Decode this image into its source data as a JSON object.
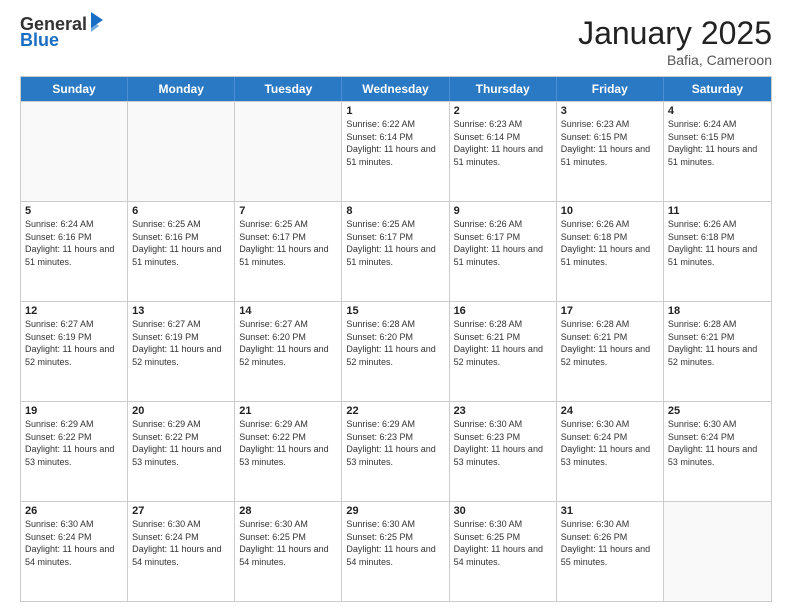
{
  "logo": {
    "general": "General",
    "blue": "Blue"
  },
  "title": "January 2025",
  "location": "Bafia, Cameroon",
  "header_days": [
    "Sunday",
    "Monday",
    "Tuesday",
    "Wednesday",
    "Thursday",
    "Friday",
    "Saturday"
  ],
  "rows": [
    [
      {
        "day": "",
        "empty": true
      },
      {
        "day": "",
        "empty": true
      },
      {
        "day": "",
        "empty": true
      },
      {
        "day": "1",
        "sunrise": "Sunrise: 6:22 AM",
        "sunset": "Sunset: 6:14 PM",
        "daylight": "Daylight: 11 hours and 51 minutes."
      },
      {
        "day": "2",
        "sunrise": "Sunrise: 6:23 AM",
        "sunset": "Sunset: 6:14 PM",
        "daylight": "Daylight: 11 hours and 51 minutes."
      },
      {
        "day": "3",
        "sunrise": "Sunrise: 6:23 AM",
        "sunset": "Sunset: 6:15 PM",
        "daylight": "Daylight: 11 hours and 51 minutes."
      },
      {
        "day": "4",
        "sunrise": "Sunrise: 6:24 AM",
        "sunset": "Sunset: 6:15 PM",
        "daylight": "Daylight: 11 hours and 51 minutes."
      }
    ],
    [
      {
        "day": "5",
        "sunrise": "Sunrise: 6:24 AM",
        "sunset": "Sunset: 6:16 PM",
        "daylight": "Daylight: 11 hours and 51 minutes."
      },
      {
        "day": "6",
        "sunrise": "Sunrise: 6:25 AM",
        "sunset": "Sunset: 6:16 PM",
        "daylight": "Daylight: 11 hours and 51 minutes."
      },
      {
        "day": "7",
        "sunrise": "Sunrise: 6:25 AM",
        "sunset": "Sunset: 6:17 PM",
        "daylight": "Daylight: 11 hours and 51 minutes."
      },
      {
        "day": "8",
        "sunrise": "Sunrise: 6:25 AM",
        "sunset": "Sunset: 6:17 PM",
        "daylight": "Daylight: 11 hours and 51 minutes."
      },
      {
        "day": "9",
        "sunrise": "Sunrise: 6:26 AM",
        "sunset": "Sunset: 6:17 PM",
        "daylight": "Daylight: 11 hours and 51 minutes."
      },
      {
        "day": "10",
        "sunrise": "Sunrise: 6:26 AM",
        "sunset": "Sunset: 6:18 PM",
        "daylight": "Daylight: 11 hours and 51 minutes."
      },
      {
        "day": "11",
        "sunrise": "Sunrise: 6:26 AM",
        "sunset": "Sunset: 6:18 PM",
        "daylight": "Daylight: 11 hours and 51 minutes."
      }
    ],
    [
      {
        "day": "12",
        "sunrise": "Sunrise: 6:27 AM",
        "sunset": "Sunset: 6:19 PM",
        "daylight": "Daylight: 11 hours and 52 minutes."
      },
      {
        "day": "13",
        "sunrise": "Sunrise: 6:27 AM",
        "sunset": "Sunset: 6:19 PM",
        "daylight": "Daylight: 11 hours and 52 minutes."
      },
      {
        "day": "14",
        "sunrise": "Sunrise: 6:27 AM",
        "sunset": "Sunset: 6:20 PM",
        "daylight": "Daylight: 11 hours and 52 minutes."
      },
      {
        "day": "15",
        "sunrise": "Sunrise: 6:28 AM",
        "sunset": "Sunset: 6:20 PM",
        "daylight": "Daylight: 11 hours and 52 minutes."
      },
      {
        "day": "16",
        "sunrise": "Sunrise: 6:28 AM",
        "sunset": "Sunset: 6:21 PM",
        "daylight": "Daylight: 11 hours and 52 minutes."
      },
      {
        "day": "17",
        "sunrise": "Sunrise: 6:28 AM",
        "sunset": "Sunset: 6:21 PM",
        "daylight": "Daylight: 11 hours and 52 minutes."
      },
      {
        "day": "18",
        "sunrise": "Sunrise: 6:28 AM",
        "sunset": "Sunset: 6:21 PM",
        "daylight": "Daylight: 11 hours and 52 minutes."
      }
    ],
    [
      {
        "day": "19",
        "sunrise": "Sunrise: 6:29 AM",
        "sunset": "Sunset: 6:22 PM",
        "daylight": "Daylight: 11 hours and 53 minutes."
      },
      {
        "day": "20",
        "sunrise": "Sunrise: 6:29 AM",
        "sunset": "Sunset: 6:22 PM",
        "daylight": "Daylight: 11 hours and 53 minutes."
      },
      {
        "day": "21",
        "sunrise": "Sunrise: 6:29 AM",
        "sunset": "Sunset: 6:22 PM",
        "daylight": "Daylight: 11 hours and 53 minutes."
      },
      {
        "day": "22",
        "sunrise": "Sunrise: 6:29 AM",
        "sunset": "Sunset: 6:23 PM",
        "daylight": "Daylight: 11 hours and 53 minutes."
      },
      {
        "day": "23",
        "sunrise": "Sunrise: 6:30 AM",
        "sunset": "Sunset: 6:23 PM",
        "daylight": "Daylight: 11 hours and 53 minutes."
      },
      {
        "day": "24",
        "sunrise": "Sunrise: 6:30 AM",
        "sunset": "Sunset: 6:24 PM",
        "daylight": "Daylight: 11 hours and 53 minutes."
      },
      {
        "day": "25",
        "sunrise": "Sunrise: 6:30 AM",
        "sunset": "Sunset: 6:24 PM",
        "daylight": "Daylight: 11 hours and 53 minutes."
      }
    ],
    [
      {
        "day": "26",
        "sunrise": "Sunrise: 6:30 AM",
        "sunset": "Sunset: 6:24 PM",
        "daylight": "Daylight: 11 hours and 54 minutes."
      },
      {
        "day": "27",
        "sunrise": "Sunrise: 6:30 AM",
        "sunset": "Sunset: 6:24 PM",
        "daylight": "Daylight: 11 hours and 54 minutes."
      },
      {
        "day": "28",
        "sunrise": "Sunrise: 6:30 AM",
        "sunset": "Sunset: 6:25 PM",
        "daylight": "Daylight: 11 hours and 54 minutes."
      },
      {
        "day": "29",
        "sunrise": "Sunrise: 6:30 AM",
        "sunset": "Sunset: 6:25 PM",
        "daylight": "Daylight: 11 hours and 54 minutes."
      },
      {
        "day": "30",
        "sunrise": "Sunrise: 6:30 AM",
        "sunset": "Sunset: 6:25 PM",
        "daylight": "Daylight: 11 hours and 54 minutes."
      },
      {
        "day": "31",
        "sunrise": "Sunrise: 6:30 AM",
        "sunset": "Sunset: 6:26 PM",
        "daylight": "Daylight: 11 hours and 55 minutes."
      },
      {
        "day": "",
        "empty": true
      }
    ]
  ]
}
